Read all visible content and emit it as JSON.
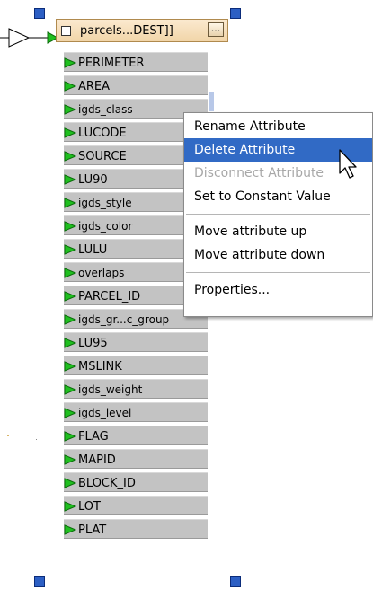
{
  "transformer": {
    "title": "parcels...DEST]]",
    "dots_label": "...",
    "attributes": [
      {
        "label": "PERIMETER"
      },
      {
        "label": "AREA"
      },
      {
        "label": "igds_class"
      },
      {
        "label": "LUCODE"
      },
      {
        "label": "SOURCE"
      },
      {
        "label": "LU90"
      },
      {
        "label": "igds_style"
      },
      {
        "label": "igds_color"
      },
      {
        "label": "LULU"
      },
      {
        "label": "overlaps"
      },
      {
        "label": "PARCEL_ID"
      },
      {
        "label": "igds_gr...c_group"
      },
      {
        "label": "LU95"
      },
      {
        "label": "MSLINK"
      },
      {
        "label": "igds_weight"
      },
      {
        "label": "igds_level"
      },
      {
        "label": "FLAG"
      },
      {
        "label": "MAPID"
      },
      {
        "label": "BLOCK_ID"
      },
      {
        "label": "LOT"
      },
      {
        "label": "PLAT"
      }
    ]
  },
  "context_menu": {
    "items": [
      {
        "label": "Rename Attribute"
      },
      {
        "label": "Delete Attribute"
      },
      {
        "label": "Disconnect Attribute"
      },
      {
        "label": "Set to Constant Value"
      },
      {
        "label": "Move attribute up"
      },
      {
        "label": "Move attribute down"
      },
      {
        "label": "Properties..."
      }
    ]
  },
  "icons": {
    "port": "green-arrow-icon",
    "cursor": "mouse-pointer-icon",
    "input": "input-port-icon"
  },
  "colors": {
    "port_green": "#1fbf1f",
    "menu_highlight": "#316ac5",
    "handle_blue": "#2c5fc4",
    "attr_bar": "#c3c3c3",
    "header": "#f1d5a8"
  }
}
